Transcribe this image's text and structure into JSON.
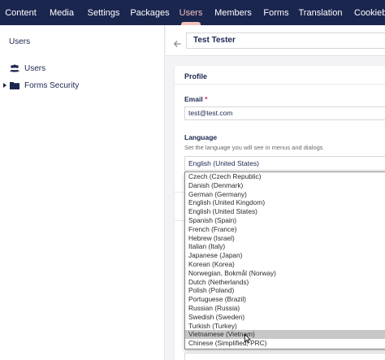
{
  "nav": {
    "items": [
      {
        "label": "Content",
        "active": false
      },
      {
        "label": "Media",
        "active": false
      },
      {
        "label": "Settings",
        "active": false
      },
      {
        "label": "Packages",
        "active": false
      },
      {
        "label": "Users",
        "active": true
      },
      {
        "label": "Members",
        "active": false
      },
      {
        "label": "Forms",
        "active": false
      },
      {
        "label": "Translation",
        "active": false
      },
      {
        "label": "Cookieb",
        "active": false
      }
    ]
  },
  "sidebar": {
    "title": "Users",
    "items": [
      {
        "label": "Users",
        "icon": "users-icon"
      },
      {
        "label": "Forms Security",
        "icon": "folder-icon"
      }
    ]
  },
  "header": {
    "user_name": "Test Tester"
  },
  "profile": {
    "title": "Profile",
    "email_label": "Email",
    "required_mark": "*",
    "email_value": "test@test.com",
    "language_label": "Language",
    "language_desc": "Set the language you will see in menus and dialogs",
    "language_selected": "English (United States)",
    "language_options": [
      "Czech (Czech Republic)",
      "Danish (Denmark)",
      "German (Germany)",
      "English (United Kingdom)",
      "English (United States)",
      "Spanish (Spain)",
      "French (France)",
      "Hebrew (Israel)",
      "Italian (Italy)",
      "Japanese (Japan)",
      "Korean (Korea)",
      "Norwegian, Bokmål (Norway)",
      "Dutch (Netherlands)",
      "Polish (Poland)",
      "Portuguese (Brazil)",
      "Russian (Russia)",
      "Swedish (Sweden)",
      "Turkish (Turkey)",
      "Vietnamese (Vietnam)",
      "Chinese (Simplified, PRC)"
    ],
    "highlighted_option": "Vietnamese (Vietnam)"
  },
  "colors": {
    "nav_bg": "#1b264f",
    "nav_active": "#f5c1bc",
    "text_primary": "#1b264f",
    "required": "#d42054"
  }
}
